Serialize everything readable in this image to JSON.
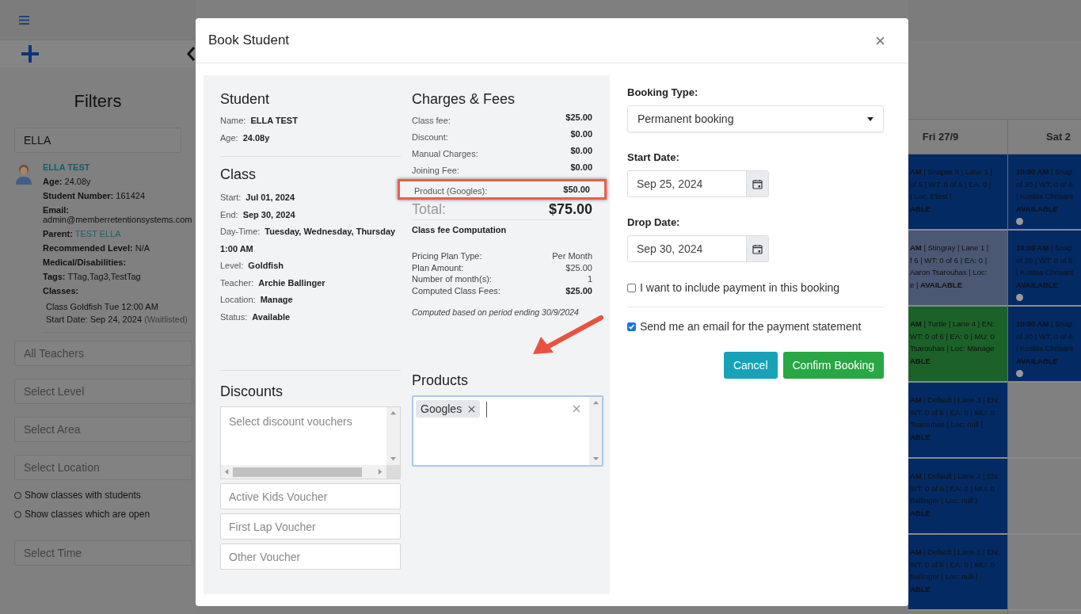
{
  "sidebar": {
    "title": "Filters",
    "search": {
      "value": "ELLA"
    },
    "student": {
      "name": "ELLA TEST",
      "fields": [
        {
          "label": "Age:",
          "value": "24.08y",
          "kind": "inline"
        },
        {
          "label": "Student Number:",
          "value": "161424",
          "kind": "inline"
        },
        {
          "label": "Email:",
          "value": "admin@memberretentionsystems.com",
          "kind": "below"
        },
        {
          "label": "Parent:",
          "value": "TEST ELLA",
          "kind": "link"
        },
        {
          "label": "Recommended Level:",
          "value": "N/A",
          "kind": "inline"
        },
        {
          "label": "Medical/Disabilities:",
          "kind": "inline"
        },
        {
          "label": "Tags:",
          "value": "TTag,Tag3,TestTag",
          "kind": "inline"
        }
      ],
      "classes": {
        "label": "Classes:",
        "lines": [
          {
            "text": "Class Goldfish Tue 12:00 AM"
          },
          {
            "text": "Start Date: Sep 24, 2024",
            "note": "(Waitlisted)"
          }
        ]
      }
    },
    "filters": [
      {
        "placeholder": "All Teachers"
      },
      {
        "placeholder": "Select Level"
      },
      {
        "placeholder": "Select Area"
      },
      {
        "placeholder": "Select Location"
      }
    ],
    "options": [
      {
        "label": "Show classes with students",
        "selected": false
      },
      {
        "label": "Show classes which are open",
        "selected": false
      }
    ],
    "time_filter": {
      "placeholder": "Select Time"
    }
  },
  "modal": {
    "title": "Book Student",
    "student": {
      "heading": "Student",
      "fields": [
        {
          "label": "Name:",
          "value": "ELLA TEST"
        },
        {
          "label": "Age:",
          "value": "24.08y"
        }
      ]
    },
    "class": {
      "heading": "Class",
      "fields": [
        {
          "label": "Start:",
          "value": "Jul 01, 2024"
        },
        {
          "label": "End:",
          "value": "Sep 30, 2024"
        },
        {
          "label": "Day-Time:",
          "value": "Tuesday, Wednesday, Thursday 1:00 AM"
        },
        {
          "label": "Level:",
          "value": "Goldfish"
        },
        {
          "label": "Teacher:",
          "value": "Archie Ballinger"
        },
        {
          "label": "Location:",
          "value": "Manage"
        },
        {
          "label": "Status:",
          "value": "Available"
        }
      ]
    },
    "charges": {
      "heading": "Charges & Fees",
      "rows": [
        {
          "label": "Class fee:",
          "value": "$25.00",
          "highlighted": false
        },
        {
          "label": "Discount:",
          "value": "$0.00",
          "highlighted": false
        },
        {
          "label": "Manual Charges:",
          "value": "$0.00",
          "highlighted": false
        },
        {
          "label": "Joining Fee:",
          "value": "$0.00",
          "highlighted": false
        },
        {
          "label": "Product (Googles):",
          "value": "$50.00",
          "highlighted": true
        }
      ],
      "total": {
        "label": "Total:",
        "value": "$75.00"
      },
      "computation": {
        "heading": "Class fee Computation",
        "rows": [
          {
            "label": "Pricing Plan Type:",
            "value": "Per Month",
            "strong": false
          },
          {
            "label": "Plan Amount:",
            "value": "$25.00",
            "strong": false
          },
          {
            "label": "Number of month(s):",
            "value": "1",
            "strong": false
          },
          {
            "label": "Computed Class Fees:",
            "value": "$25.00",
            "strong": true
          }
        ],
        "note": "Computed based on period ending 30/9/2024"
      }
    },
    "discounts": {
      "heading": "Discounts",
      "placeholder": "Select discount vouchers",
      "vouchers": [
        "Active Kids Voucher",
        "First Lap Voucher",
        "Other Voucher"
      ]
    },
    "products": {
      "heading": "Products",
      "tags": [
        "Googles"
      ]
    },
    "form": {
      "booking_type": {
        "label": "Booking Type:",
        "value": "Permanent booking"
      },
      "start_date": {
        "label": "Start Date:",
        "value": "Sep 25, 2024"
      },
      "drop_date": {
        "label": "Drop Date:",
        "value": "Sep 30, 2024"
      },
      "include_payment": {
        "label": "I want to include payment in this booking",
        "checked": false
      },
      "send_email": {
        "label": "Send me an email for the payment statement",
        "checked": true
      },
      "buttons": [
        {
          "label": "Cancel",
          "kind": "secondary"
        },
        {
          "label": "Confirm Booking",
          "kind": "primary"
        }
      ]
    }
  },
  "calendar": {
    "columns": [
      {
        "header": "Fri 27/9",
        "cells": [
          {
            "kind": "class",
            "color": "#032a63",
            "dot": false,
            "lines": [
              "**AM** | Snapss 8 | Lane 1 |",
              "of 5 | WT: 0 of 6 | EA: 0 |",
              "| Loc: Etest |",
              "**ABLE**"
            ]
          },
          {
            "kind": "class",
            "color": "#4b5873",
            "dot": false,
            "lines": [
              "**AM** | Stingray | Lane 1 |",
              "f 6 | WT: 0 of 6 | EA: 0 |",
              "Aaron Tsarouhas | Loc:",
              "e | **AVAILABLE**"
            ]
          },
          {
            "kind": "class",
            "color": "#1c6129",
            "dot": false,
            "lines": [
              "**AM** | Turtle | Lane 4 | EN:",
              "WT: 0 of 6 | EA: 0 | MU: 0",
              "Tsarouhas | Loc: Manage",
              "**ABLE**"
            ]
          },
          {
            "kind": "class",
            "color": "#032a63",
            "dot": false,
            "lines": [
              "**AM** | Default | Lane 3 | EN:",
              "WT: 0 of 6 | EA: 0 | MU: 0",
              "Tsarouhas | Loc: null |",
              "**ABLE**"
            ]
          },
          {
            "kind": "class",
            "color": "#032a63",
            "dot": false,
            "lines": [
              "**AM** | Default | Lane 2 | EN:",
              "WT: 0 of 6 | EA: 0 | MU: 0",
              "Ballinger | Loc: null |",
              "**ABLE**"
            ]
          },
          {
            "kind": "class",
            "color": "#032a63",
            "dot": false,
            "lines": [
              "**AM** | Default | Lane 1 | EN:",
              "WT: 0 of 6 | EA: 0 | MU: 0",
              "Ballinger | Loc: null |",
              "**ABLE**"
            ]
          }
        ]
      },
      {
        "header": "Sat 2",
        "cells": [
          {
            "kind": "class",
            "color": "#032a63",
            "dot": true,
            "lines": [
              "**10:00 AM** | Snap",
              "of 20 | WT: 0 of 6",
              "| Kostas Chrisant",
              "**AVAILABLE**"
            ]
          },
          {
            "kind": "class",
            "color": "#032a63",
            "dot": true,
            "lines": [
              "**10:00 AM** | Snap",
              "of 20 | WT: 0 of 6",
              "| Kostas Chrisant",
              "**AVAILABLE**"
            ]
          },
          {
            "kind": "class",
            "color": "#032a63",
            "dot": true,
            "lines": [
              "**10:00 AM** | Snap",
              "of 20 | WT: 0 of 6",
              "| Kostas Chrisant",
              "**AVAILABLE**"
            ]
          },
          {
            "kind": "empty"
          },
          {
            "kind": "empty"
          },
          {
            "kind": "empty"
          }
        ]
      }
    ]
  }
}
